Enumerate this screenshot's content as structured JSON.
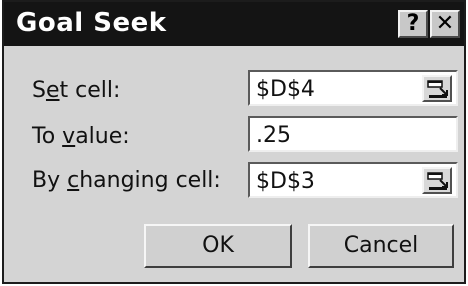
{
  "dialog": {
    "title": "Goal Seek",
    "help_label": "?",
    "close_label": "✕"
  },
  "fields": {
    "set_cell": {
      "label_pre": "S",
      "label_ul": "e",
      "label_post": "t cell:",
      "value": "$D$4"
    },
    "to_value": {
      "label_pre": "To ",
      "label_ul": "v",
      "label_post": "alue:",
      "value": ".25"
    },
    "changing_cell": {
      "label_pre": "By ",
      "label_ul": "c",
      "label_post": "hanging cell:",
      "value": "$D$3"
    }
  },
  "buttons": {
    "ok_label": "OK",
    "cancel_label": "Cancel"
  },
  "icons": {
    "ref_icon": "collapse-dialog-icon"
  }
}
